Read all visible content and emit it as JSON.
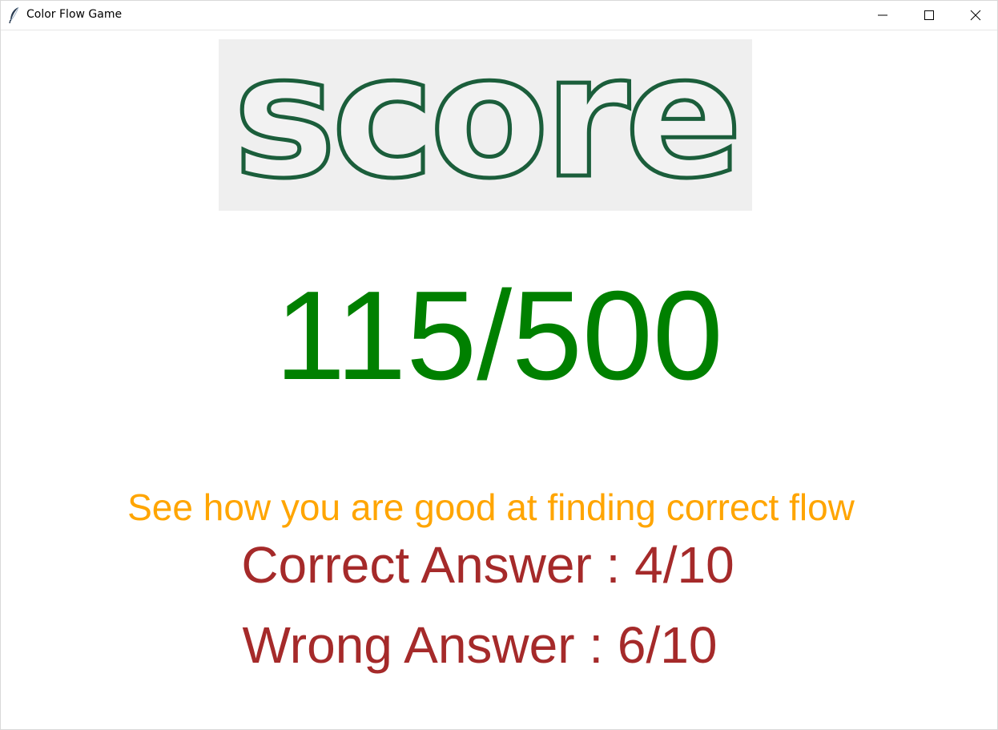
{
  "window": {
    "title": "Color Flow Game",
    "icon": "feather-icon",
    "controls": [
      "minimize-icon",
      "maximize-icon",
      "close-icon"
    ]
  },
  "logo": {
    "text": "score",
    "stroke_color": "#1b5e3b",
    "background_color": "#efefef"
  },
  "score": {
    "value": "115/500",
    "color": "#008000"
  },
  "tagline": {
    "text": "See how you are good at finding correct flow",
    "color": "#ffa500"
  },
  "results": {
    "correct_text": "Correct Answer : 4/10",
    "wrong_text": "Wrong Answer : 6/10",
    "color": "#a52a2a"
  }
}
